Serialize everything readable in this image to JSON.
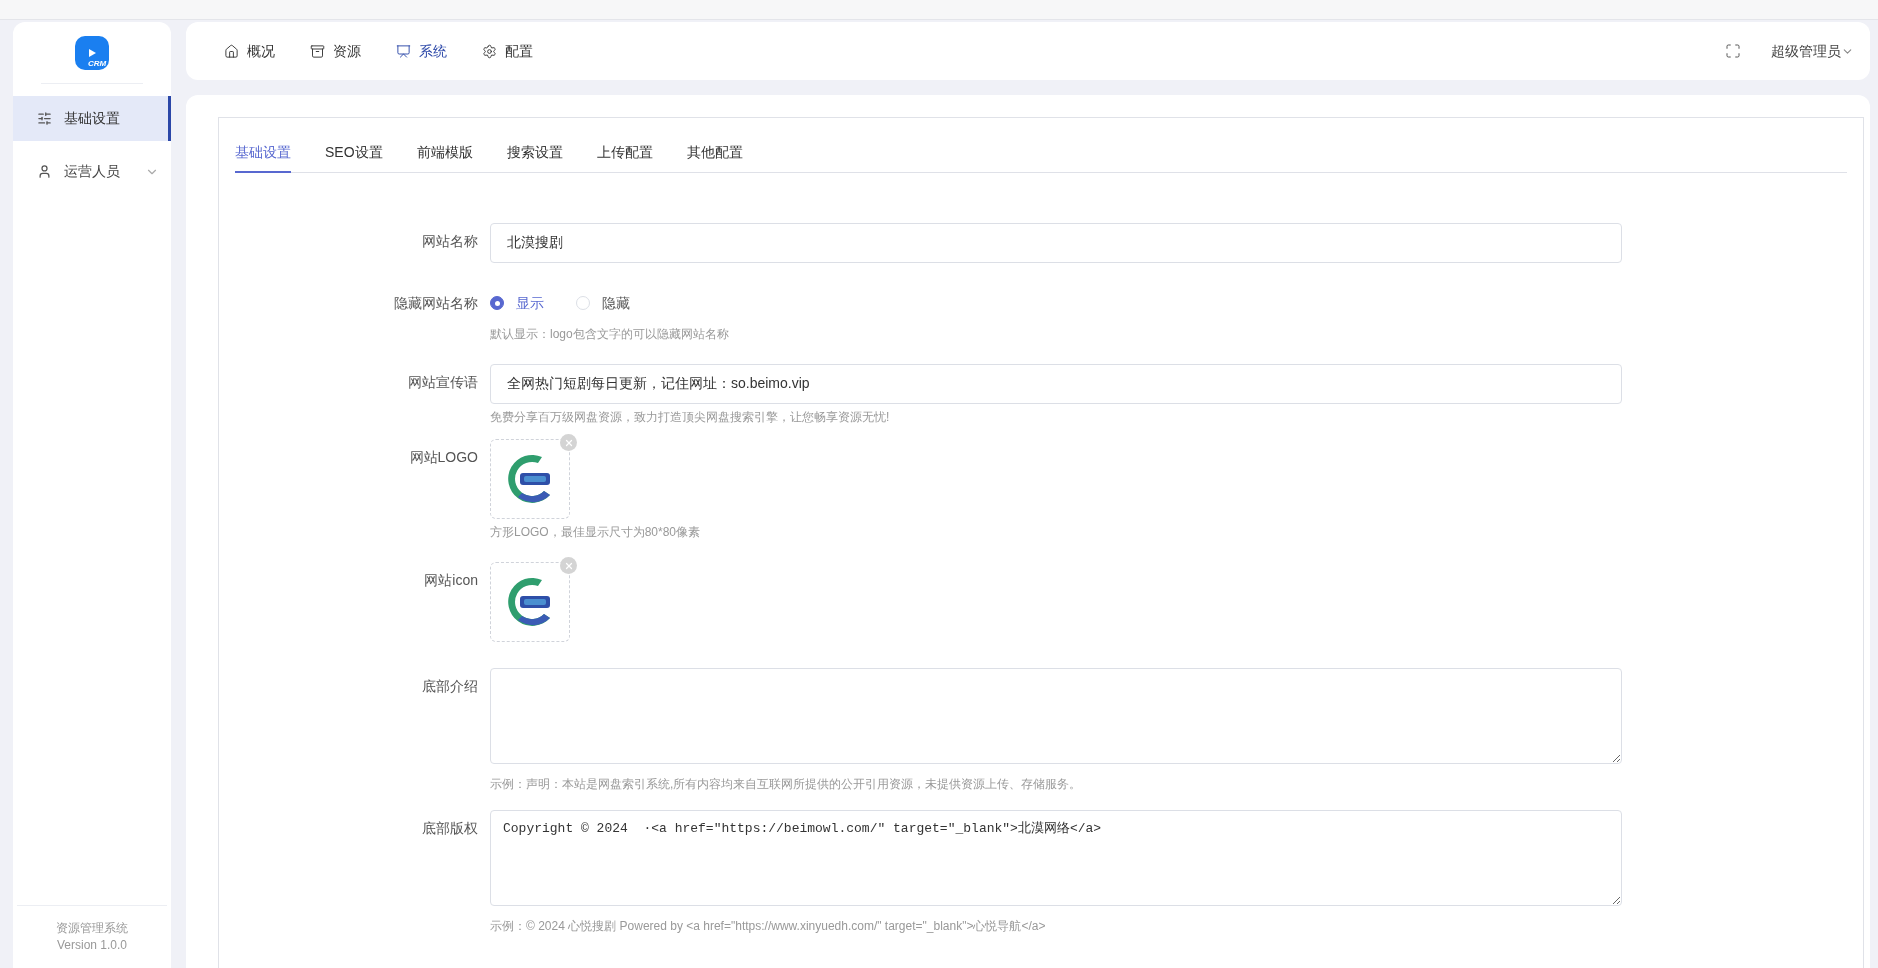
{
  "sidebar": {
    "logo_text": "CRM",
    "items": [
      {
        "label": "基础设置",
        "selected": true,
        "expandable": false
      },
      {
        "label": "运营人员",
        "selected": false,
        "expandable": true
      }
    ],
    "footer": [
      "资源管理系统",
      "Version 1.0.0"
    ]
  },
  "top_nav": {
    "items": [
      {
        "label": "概况",
        "selected": false
      },
      {
        "label": "资源",
        "selected": false
      },
      {
        "label": "系统",
        "selected": true
      },
      {
        "label": "配置",
        "selected": false
      }
    ],
    "user": "超级管理员"
  },
  "tabs": [
    {
      "label": "基础设置",
      "selected": true
    },
    {
      "label": "SEO设置",
      "selected": false
    },
    {
      "label": "前端模版",
      "selected": false
    },
    {
      "label": "搜索设置",
      "selected": false
    },
    {
      "label": "上传配置",
      "selected": false
    },
    {
      "label": "其他配置",
      "selected": false
    }
  ],
  "form": {
    "fields": [
      {
        "kind": "input",
        "label": "网站名称",
        "value": "北漠搜剧"
      },
      {
        "kind": "radio",
        "label": "隐藏网站名称",
        "options": [
          {
            "label": "显示",
            "selected": true
          },
          {
            "label": "隐藏",
            "selected": false
          }
        ],
        "hint": "默认显示：logo包含文字的可以隐藏网站名称"
      },
      {
        "kind": "input",
        "label": "网站宣传语",
        "value": "全网热门短剧每日更新，记住网址：so.beimo.vip",
        "hint": "免费分享百万级网盘资源，致力打造顶尖网盘搜索引擎，让您畅享资源无忧!"
      },
      {
        "label": "网站LOGO",
        "hint": "方形LOGO，最佳显示尺寸为80*80像素"
      },
      {
        "label": "网站icon"
      },
      {
        "kind": "textarea",
        "label": "底部介绍",
        "hint": "示例：声明：本站是网盘索引系统,所有内容均来自互联网所提供的公开引用资源，未提供资源上传、存储服务。"
      },
      {
        "kind": "code",
        "label": "底部版权",
        "value": "Copyright © 2024  ·<a href=\"https://beimowl.com/\" target=\"_blank\">北漠网络</a>",
        "hint": "示例：© 2024 心悦搜剧 Powered by <a href=\"https://www.xinyuedh.com/\" target=\"_blank\">心悦导航</a>"
      }
    ]
  }
}
